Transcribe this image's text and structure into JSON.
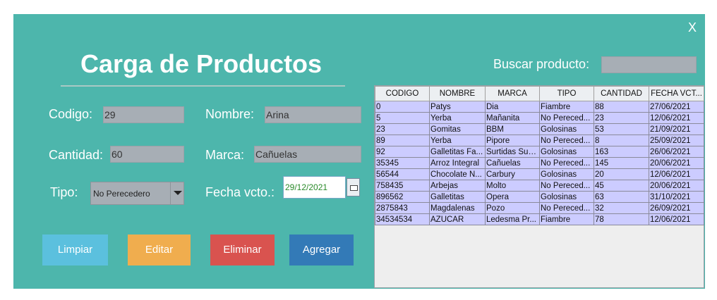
{
  "window": {
    "close_label": "X"
  },
  "form": {
    "title": "Carga de Productos",
    "codigo_label": "Codigo:",
    "codigo_value": "29",
    "nombre_label": "Nombre:",
    "nombre_value": "Arina",
    "cantidad_label": "Cantidad:",
    "cantidad_value": "60",
    "marca_label": "Marca:",
    "marca_value": "Cañuelas",
    "tipo_label": "Tipo:",
    "tipo_value": "No Perecedero",
    "fecha_label": "Fecha vcto.:",
    "fecha_value": "29/12/2021"
  },
  "search": {
    "label": "Buscar producto:",
    "value": ""
  },
  "buttons": {
    "limpiar": "Limpiar",
    "editar": "Editar",
    "eliminar": "Eliminar",
    "agregar": "Agregar"
  },
  "colors": {
    "window_bg": "#4db6ac",
    "limpiar": "#5bc0de",
    "editar": "#f0ad4e",
    "eliminar": "#d9534f",
    "agregar": "#337ab7",
    "row_bg": "#ccccff"
  },
  "table": {
    "columns": [
      "CODIGO",
      "NOMBRE",
      "MARCA",
      "TIPO",
      "CANTIDAD",
      "FECHA VCT..."
    ],
    "rows": [
      [
        "0",
        "Patys",
        "Dia",
        "Fiambre",
        "88",
        "27/06/2021"
      ],
      [
        "5",
        "Yerba",
        "Mañanita",
        "No Pereced...",
        "23",
        "12/06/2021"
      ],
      [
        "23",
        "Gomitas",
        "BBM",
        "Golosinas",
        "53",
        "21/09/2021"
      ],
      [
        "89",
        "Yerba",
        "Pipore",
        "No Pereced...",
        "8",
        "25/09/2021"
      ],
      [
        "92",
        "Galletitas Fa...",
        "Surtidas Super",
        "Golosinas",
        "163",
        "26/06/2021"
      ],
      [
        "35345",
        "Arroz Integral",
        "Cañuelas",
        "No Pereced...",
        "145",
        "20/06/2021"
      ],
      [
        "56544",
        "Chocolate N...",
        "Carbury",
        "Golosinas",
        "20",
        "12/06/2021"
      ],
      [
        "758435",
        "Arbejas",
        "Molto",
        "No Pereced...",
        "45",
        "20/06/2021"
      ],
      [
        "896562",
        "Galletitas",
        "Opera",
        "Golosinas",
        "63",
        "31/10/2021"
      ],
      [
        "2875843",
        "Magdalenas",
        "Pozo",
        "No Pereced...",
        "32",
        "26/09/2021"
      ],
      [
        "34534534",
        "AZUCAR",
        "Ledesma Pr...",
        "Fiambre",
        "78",
        "12/06/2021"
      ]
    ]
  }
}
